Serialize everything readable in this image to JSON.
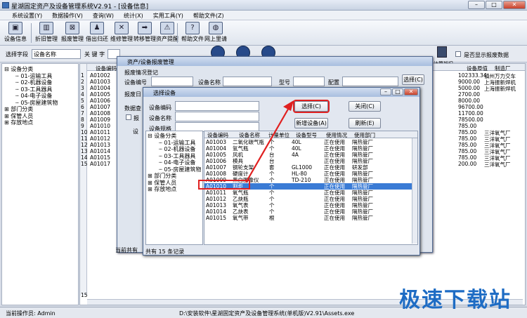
{
  "window": {
    "title": "星湖固定资产及设备管理系统V2.91 - [设备信息]"
  },
  "menu": [
    "系统设置(Y)",
    "数据操作(V)",
    "查询(W)",
    "统计(X)",
    "实用工具(Y)",
    "帮助文件(Z)"
  ],
  "toolbar": [
    {
      "label": "设备信息",
      "icon": "monitor-icon",
      "glyph": "▣"
    },
    {
      "label": "折旧管理",
      "icon": "chart-icon",
      "glyph": "▥"
    },
    {
      "label": "报废管理",
      "icon": "scrap-icon",
      "glyph": "⊠"
    },
    {
      "label": "借出归还",
      "icon": "person-icon",
      "glyph": "♟"
    },
    {
      "label": "维修管理",
      "icon": "wrench-icon",
      "glyph": "✕"
    },
    {
      "label": "转移管理",
      "icon": "arrow-icon",
      "glyph": "➡"
    },
    {
      "label": "资产提醒",
      "icon": "warning-icon",
      "glyph": "⚠"
    },
    {
      "label": "帮助文件",
      "icon": "help-book-icon",
      "glyph": "?"
    },
    {
      "label": "网上里请",
      "icon": "globe-icon",
      "glyph": "◍"
    }
  ],
  "filter": {
    "field_label": "选择字段",
    "field_value": "设备名称",
    "keyword_label": "关 键 字",
    "show_scrap_label": "是否显示报废数据",
    "depr_label": "计算折旧"
  },
  "tree": [
    {
      "t": "设备分类",
      "lvl": 0,
      "s": "⊟"
    },
    {
      "t": "01-运输工具",
      "lvl": 1
    },
    {
      "t": "02-机器设备",
      "lvl": 1
    },
    {
      "t": "03-工具器具",
      "lvl": 1
    },
    {
      "t": "04-电子设备",
      "lvl": 1
    },
    {
      "t": "05-房屋建筑物",
      "lvl": 1
    },
    {
      "t": "部门分类",
      "lvl": 0,
      "s": "⊞"
    },
    {
      "t": "保管人员",
      "lvl": 0,
      "s": "⊞"
    },
    {
      "t": "存放地点",
      "lvl": 0,
      "s": "⊞"
    }
  ],
  "main_grid": {
    "headers": [
      "设备编码",
      "设备原值",
      "制造厂"
    ],
    "codes": [
      "A01002",
      "A01003",
      "A01004",
      "A01005",
      "A01006",
      "A01007",
      "A01008",
      "A01009",
      "A01010",
      "A01011",
      "A01012",
      "A01013",
      "A01014",
      "A01015",
      "A01017"
    ],
    "values": [
      "102333.34",
      "9000.00",
      "5000.00",
      "2700.00",
      "8000.00",
      "96700.00",
      "11700.00",
      "78500.00",
      "785.00",
      "785.00",
      "785.00",
      "785.00",
      "785.00",
      "785.00",
      "200.00"
    ],
    "makers": [
      "镇州万力交车",
      "上海振新焊机",
      "上海振新焊机",
      "",
      "",
      "",
      "",
      "",
      "",
      "三洋氧气厂",
      "三洋氧气厂",
      "三洋氧气厂",
      "三洋氧气厂",
      "三洋氧气厂",
      "三洋氧气厂"
    ],
    "row_numbers": [
      "1",
      "2",
      "3",
      "4",
      "5",
      "6",
      "7",
      "8",
      "9",
      "10",
      "11",
      "12",
      "13",
      "14",
      "15"
    ],
    "bottom_row": "15",
    "selected_code": "A0100"
  },
  "dialog1": {
    "title": "资产/设备报废管理",
    "section": "报废情况登记",
    "code_label": "设备编号",
    "name_label": "设备名称",
    "model_label": "型号",
    "config_label": "配置",
    "date_label": "报废日",
    "data_label": "数据查",
    "scrap_label": "报",
    "device_label": "设",
    "select_btn": "选择(C)",
    "footer": "当前共有"
  },
  "dialog2": {
    "title": "选择设备",
    "code_label": "设备编码",
    "name_label": "设备名称",
    "spec_label": "设备规格",
    "select_btn": "选择(C)",
    "close_btn": "关闭(C)",
    "add_btn": "新增设备(A)",
    "refresh_btn": "刷新(E)",
    "footer": "共有 15 条记录",
    "headers": [
      "设备编码",
      "设备名称",
      "计量单位",
      "设备型号",
      "使用情况",
      "使用部门"
    ],
    "rows": [
      [
        "A01003",
        "二氧化碳气瓶",
        "个",
        "40L",
        "正在使用",
        "隔热管厂"
      ],
      [
        "A01004",
        "氩气瓶",
        "个",
        "40L",
        "正在使用",
        "隔热管厂"
      ],
      [
        "A01005",
        "风机",
        "台",
        "4A",
        "正在使用",
        "隔热管厂"
      ],
      [
        "A01006",
        "模具",
        "台",
        "",
        "正在使用",
        "隔热管厂"
      ],
      [
        "A01007",
        "钢轮支架",
        "套",
        "GL1000",
        "正在使用",
        "研发部"
      ],
      [
        "A01008",
        "硬度计",
        "个",
        "HL-80",
        "正在使用",
        "隔热管厂"
      ],
      [
        "A01009",
        "黑白图像仪",
        "个",
        "TD-210",
        "正在使用",
        "隔热管厂"
      ],
      [
        "A01010",
        "割炬",
        "个",
        "",
        "正在使用",
        "隔热管厂"
      ],
      [
        "A01011",
        "氧气瓶",
        "个",
        "",
        "正在使用",
        "隔热管厂"
      ],
      [
        "A01012",
        "乙炔瓶",
        "个",
        "",
        "正在使用",
        "隔热管厂"
      ],
      [
        "A01013",
        "氧气表",
        "个",
        "",
        "正在使用",
        "隔热管厂"
      ],
      [
        "A01014",
        "乙炔表",
        "个",
        "",
        "正在使用",
        "隔热管厂"
      ],
      [
        "A01015",
        "氧气带",
        "根",
        "",
        "正在使用",
        "隔热管厂"
      ]
    ],
    "selected_index": 7
  },
  "statusbar": {
    "operator": "当前操作员: Admin",
    "path": "D:\\安装软件\\星湖固定资产及设备管理系统(单机版)V2.91\\Assets.exe"
  },
  "watermark": "极速下载站",
  "colors": {
    "selected_row": "#3a7bd5",
    "annotation": "#e02020",
    "watermark": "#1e6cc4"
  }
}
